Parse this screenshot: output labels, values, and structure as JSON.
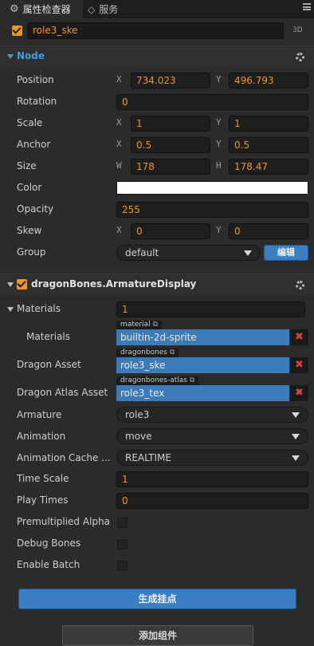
{
  "tabs": {
    "inspector": "属性检查器",
    "services": "服务"
  },
  "node_name": "role3_ske",
  "mode_3d": "3D",
  "node_section": {
    "title": "Node"
  },
  "props": {
    "position": {
      "label": "Position",
      "x": "734.023",
      "y": "496.793"
    },
    "rotation": {
      "label": "Rotation",
      "value": "0"
    },
    "scale": {
      "label": "Scale",
      "x": "1",
      "y": "1"
    },
    "anchor": {
      "label": "Anchor",
      "x": "0.5",
      "y": "0.5"
    },
    "size": {
      "label": "Size",
      "w": "178",
      "h": "178.47"
    },
    "color": {
      "label": "Color",
      "value": "#ffffff"
    },
    "opacity": {
      "label": "Opacity",
      "value": "255"
    },
    "skew": {
      "label": "Skew",
      "x": "0",
      "y": "0"
    },
    "group": {
      "label": "Group",
      "value": "default",
      "edit": "编辑"
    }
  },
  "axis_labels": {
    "x": "X",
    "y": "Y",
    "w": "W",
    "h": "H"
  },
  "component": {
    "title": "dragonBones.ArmatureDisplay",
    "materials_label": "Materials",
    "materials_count": "1",
    "material_item_label": "Materials",
    "material_tag": "material",
    "material_value": "builtin-2d-sprite",
    "dragon_asset_label": "Dragon Asset",
    "dragon_asset_tag": "dragonbones",
    "dragon_asset_value": "role3_ske",
    "atlas_label": "Dragon Atlas Asset",
    "atlas_tag": "dragonbones-atlas",
    "atlas_value": "role3_tex",
    "armature_label": "Armature",
    "armature_value": "role3",
    "animation_label": "Animation",
    "animation_value": "move",
    "cache_label": "Animation Cache ...",
    "cache_value": "REALTIME",
    "time_scale_label": "Time Scale",
    "time_scale_value": "1",
    "play_times_label": "Play Times",
    "play_times_value": "0",
    "premult_label": "Premultiplied Alpha",
    "debug_bones_label": "Debug Bones",
    "enable_batch_label": "Enable Batch"
  },
  "buttons": {
    "generate": "生成挂点",
    "add_component": "添加组件"
  }
}
